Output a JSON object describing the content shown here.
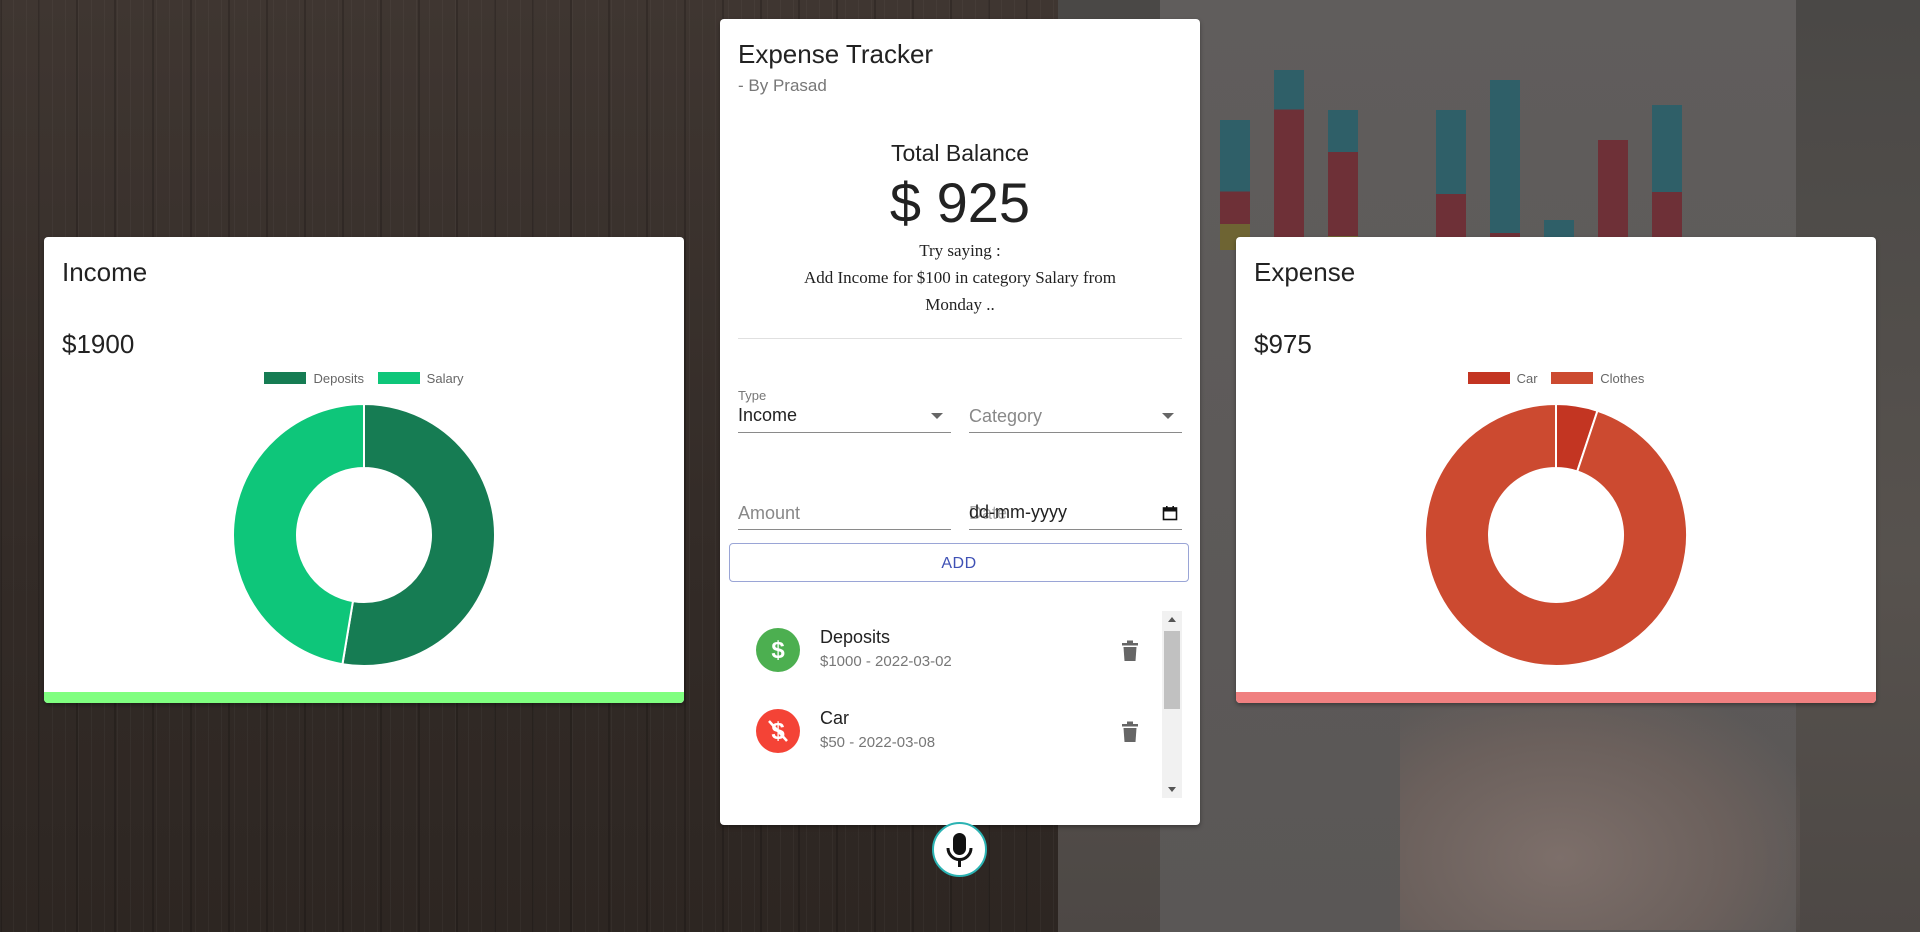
{
  "app": {
    "title": "Expense Tracker",
    "subtitle": "- By Prasad",
    "balance_label": "Total Balance",
    "balance_value": "$ 925",
    "hint_line1": "Try saying :",
    "hint_line2": "Add Income for $100 in category Salary from",
    "hint_line3": "Monday .."
  },
  "form": {
    "type_label": "Type",
    "type_value": "Income",
    "category_placeholder": "Category",
    "amount_placeholder": "Amount",
    "date_placeholder": "dd-mm-yyyy",
    "date_label_overlap": "Date",
    "add_label": "ADD"
  },
  "transactions": [
    {
      "name": "Deposits",
      "detail": "$1000 - 2022-03-02",
      "kind": "income",
      "icon": "dollar-icon",
      "color": "#4caf50"
    },
    {
      "name": "Car",
      "detail": "$50 - 2022-03-08",
      "kind": "expense",
      "icon": "money-off-icon",
      "color": "#f44336"
    }
  ],
  "income": {
    "title": "Income",
    "amount": "$1900",
    "footer_color": "#80ff80",
    "chart_data": {
      "type": "pie",
      "categories": [
        "Deposits",
        "Salary"
      ],
      "values": [
        1000,
        900
      ],
      "colors": [
        "#167c53",
        "#0ec67a"
      ]
    }
  },
  "expense": {
    "title": "Expense",
    "amount": "$975",
    "footer_color": "#f08080",
    "chart_data": {
      "type": "pie",
      "categories": [
        "Car",
        "Clothes"
      ],
      "values": [
        50,
        925
      ],
      "colors": [
        "#c33522",
        "#cc4a30"
      ]
    }
  },
  "icons": {
    "delete": "delete-icon",
    "mic": "microphone-icon",
    "dropdown": "chevron-down-icon",
    "calendar": "calendar-icon"
  }
}
